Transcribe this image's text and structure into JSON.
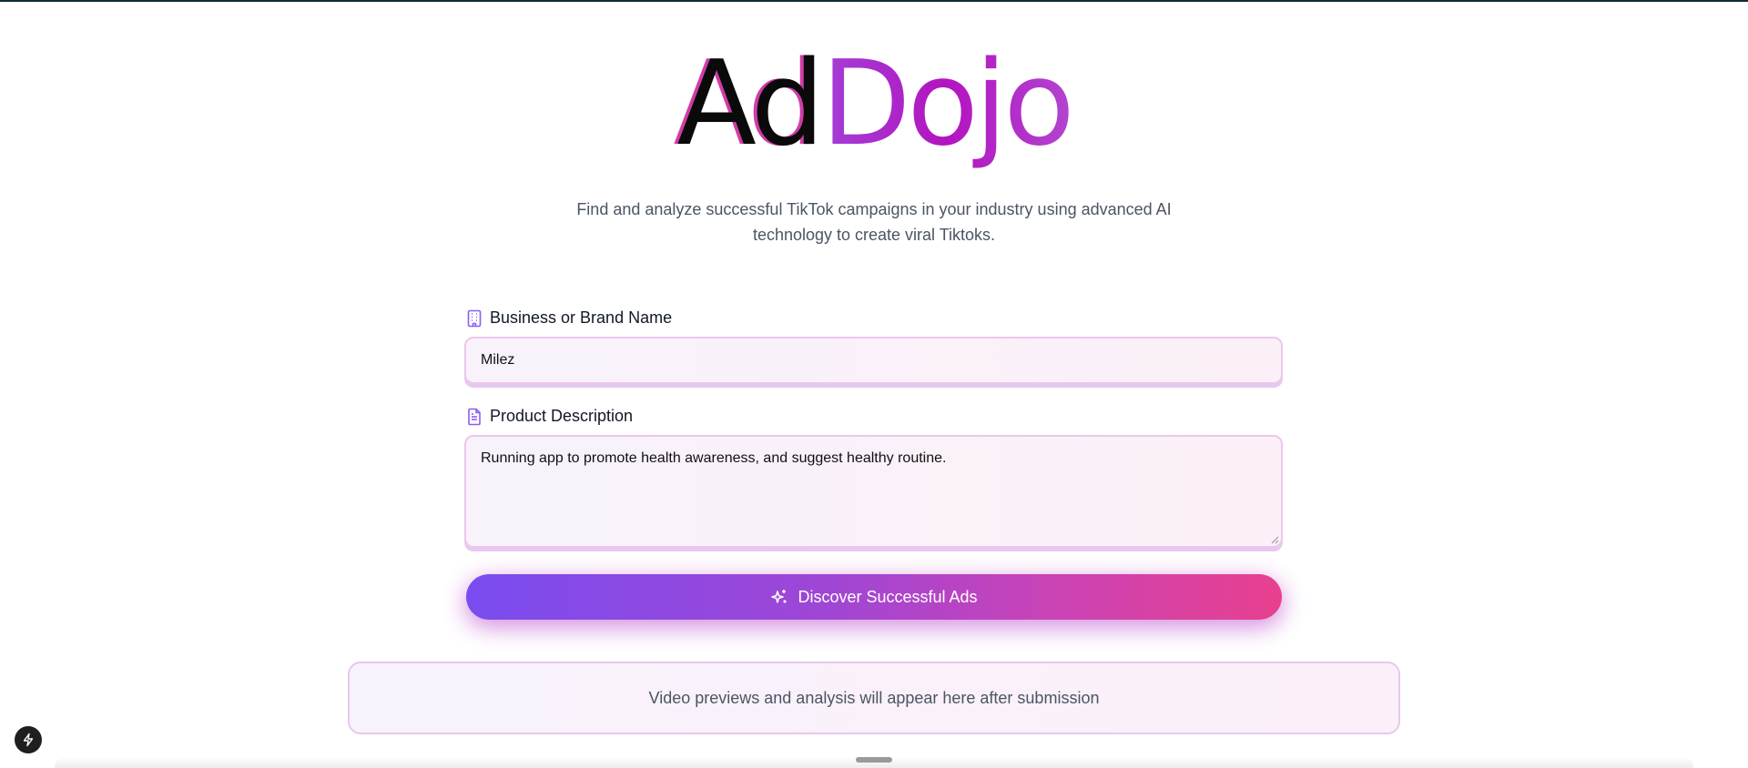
{
  "logo": {
    "part1": "Ad",
    "part2": "Dojo"
  },
  "subtitle": "Find and analyze successful TikTok campaigns in your industry using advanced AI technology to create viral Tiktoks.",
  "form": {
    "brand_label": "Business or Brand Name",
    "brand_icon": "building-icon",
    "brand_value": "Milez",
    "description_label": "Product Description",
    "description_icon": "document-icon",
    "description_value": "Running app to promote health awareness, and suggest healthy routine.",
    "submit_label": "Discover Successful Ads",
    "submit_icon": "sparkles-icon"
  },
  "results": {
    "placeholder": "Video previews and analysis will appear here after submission"
  },
  "colors": {
    "accent_purple": "#7a4cf0",
    "accent_pink": "#e8408e",
    "logo_gradient": "#b314c0"
  }
}
